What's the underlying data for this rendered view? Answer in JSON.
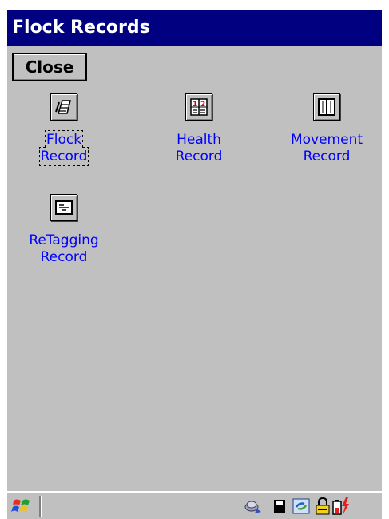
{
  "window": {
    "title": "Flock Records"
  },
  "toolbar": {
    "close_label": "Close"
  },
  "tiles": [
    {
      "label": "Flock\nRecord",
      "icon": "flock-record-icon"
    },
    {
      "label": "Health\nRecord",
      "icon": "health-record-icon"
    },
    {
      "label": "Movement\nRecord",
      "icon": "movement-record-icon"
    },
    {
      "label": "ReTagging\nRecord",
      "icon": "retagging-record-icon"
    }
  ],
  "taskbar": {
    "start_icon": "windows-flag-icon",
    "tray_icons": [
      "network-icon",
      "card-icon",
      "sync-icon",
      "lock-icon",
      "battery-charging-icon"
    ]
  },
  "colors": {
    "titlebar": "#000080",
    "background": "#c0c0c0",
    "link_text": "#0000ff"
  }
}
